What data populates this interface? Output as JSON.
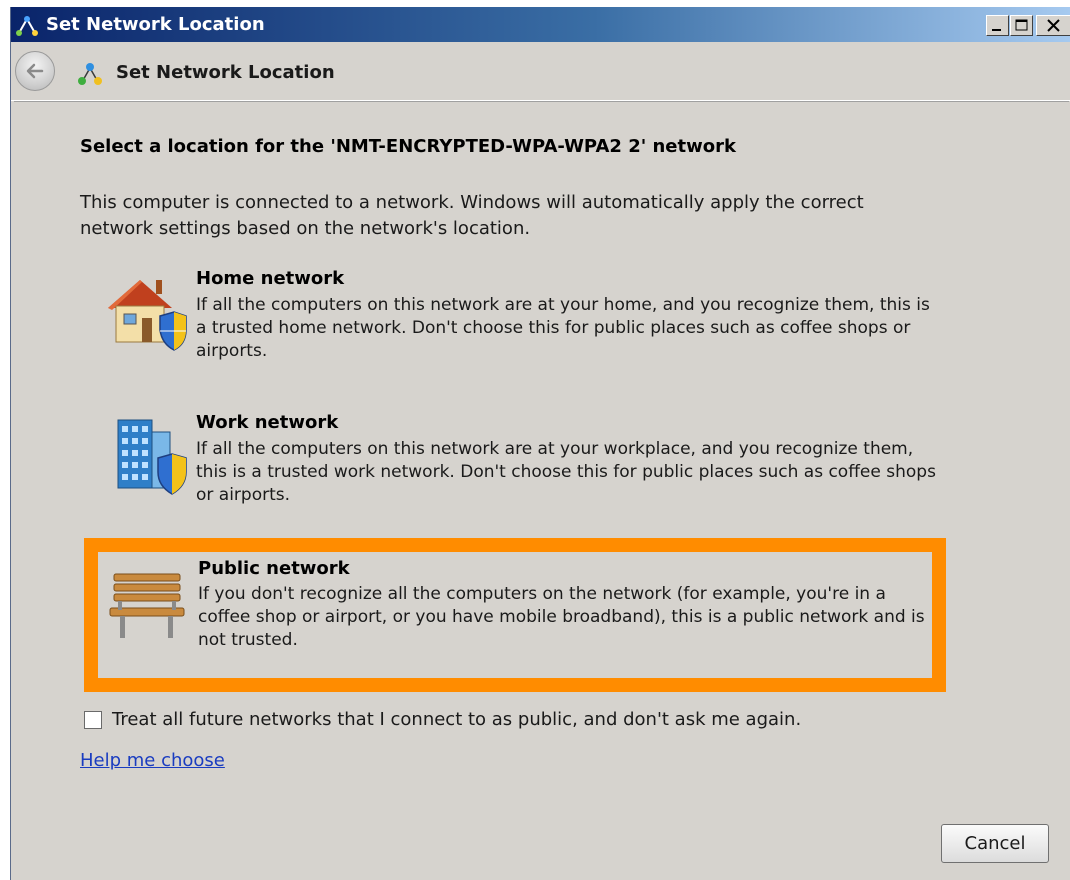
{
  "window": {
    "title": "Set Network Location",
    "caption_buttons": [
      "minimize",
      "maximize",
      "close"
    ]
  },
  "nav": {
    "back_icon": "back-arrow-icon",
    "title": "Set Network Location"
  },
  "main": {
    "heading": "Select a location for the 'NMT-ENCRYPTED-WPA-WPA2  2' network",
    "intro": "This computer is connected to a network. Windows will automatically apply the correct network settings based on the network's location.",
    "options": [
      {
        "icon": "house-shield-icon",
        "title": "Home network",
        "description": "If all the computers on this network are at your home, and you recognize them, this is a trusted home network.  Don't choose this for public places such as coffee shops or airports."
      },
      {
        "icon": "office-building-shield-icon",
        "title": "Work network",
        "description": "If all the computers on this network are at your workplace, and you recognize them, this is a trusted work network.  Don't choose this for public places such as coffee shops or airports."
      },
      {
        "icon": "park-bench-icon",
        "title": "Public network",
        "description": "If you don't recognize all the computers on the network (for example, you're in a coffee shop or airport, or you have mobile broadband), this is a public network and is not trusted.",
        "highlighted": true
      }
    ],
    "checkbox": {
      "label": "Treat all future networks that I connect to as public, and don't ask me again.",
      "checked": false
    },
    "help_link": "Help me choose"
  },
  "footer": {
    "cancel_label": "Cancel"
  },
  "colors": {
    "highlight": "#ff8c00",
    "window_bg": "#d6d3ce",
    "titlebar_start": "#0a246a",
    "titlebar_end": "#a6caf0",
    "link": "#1a3cc0"
  }
}
